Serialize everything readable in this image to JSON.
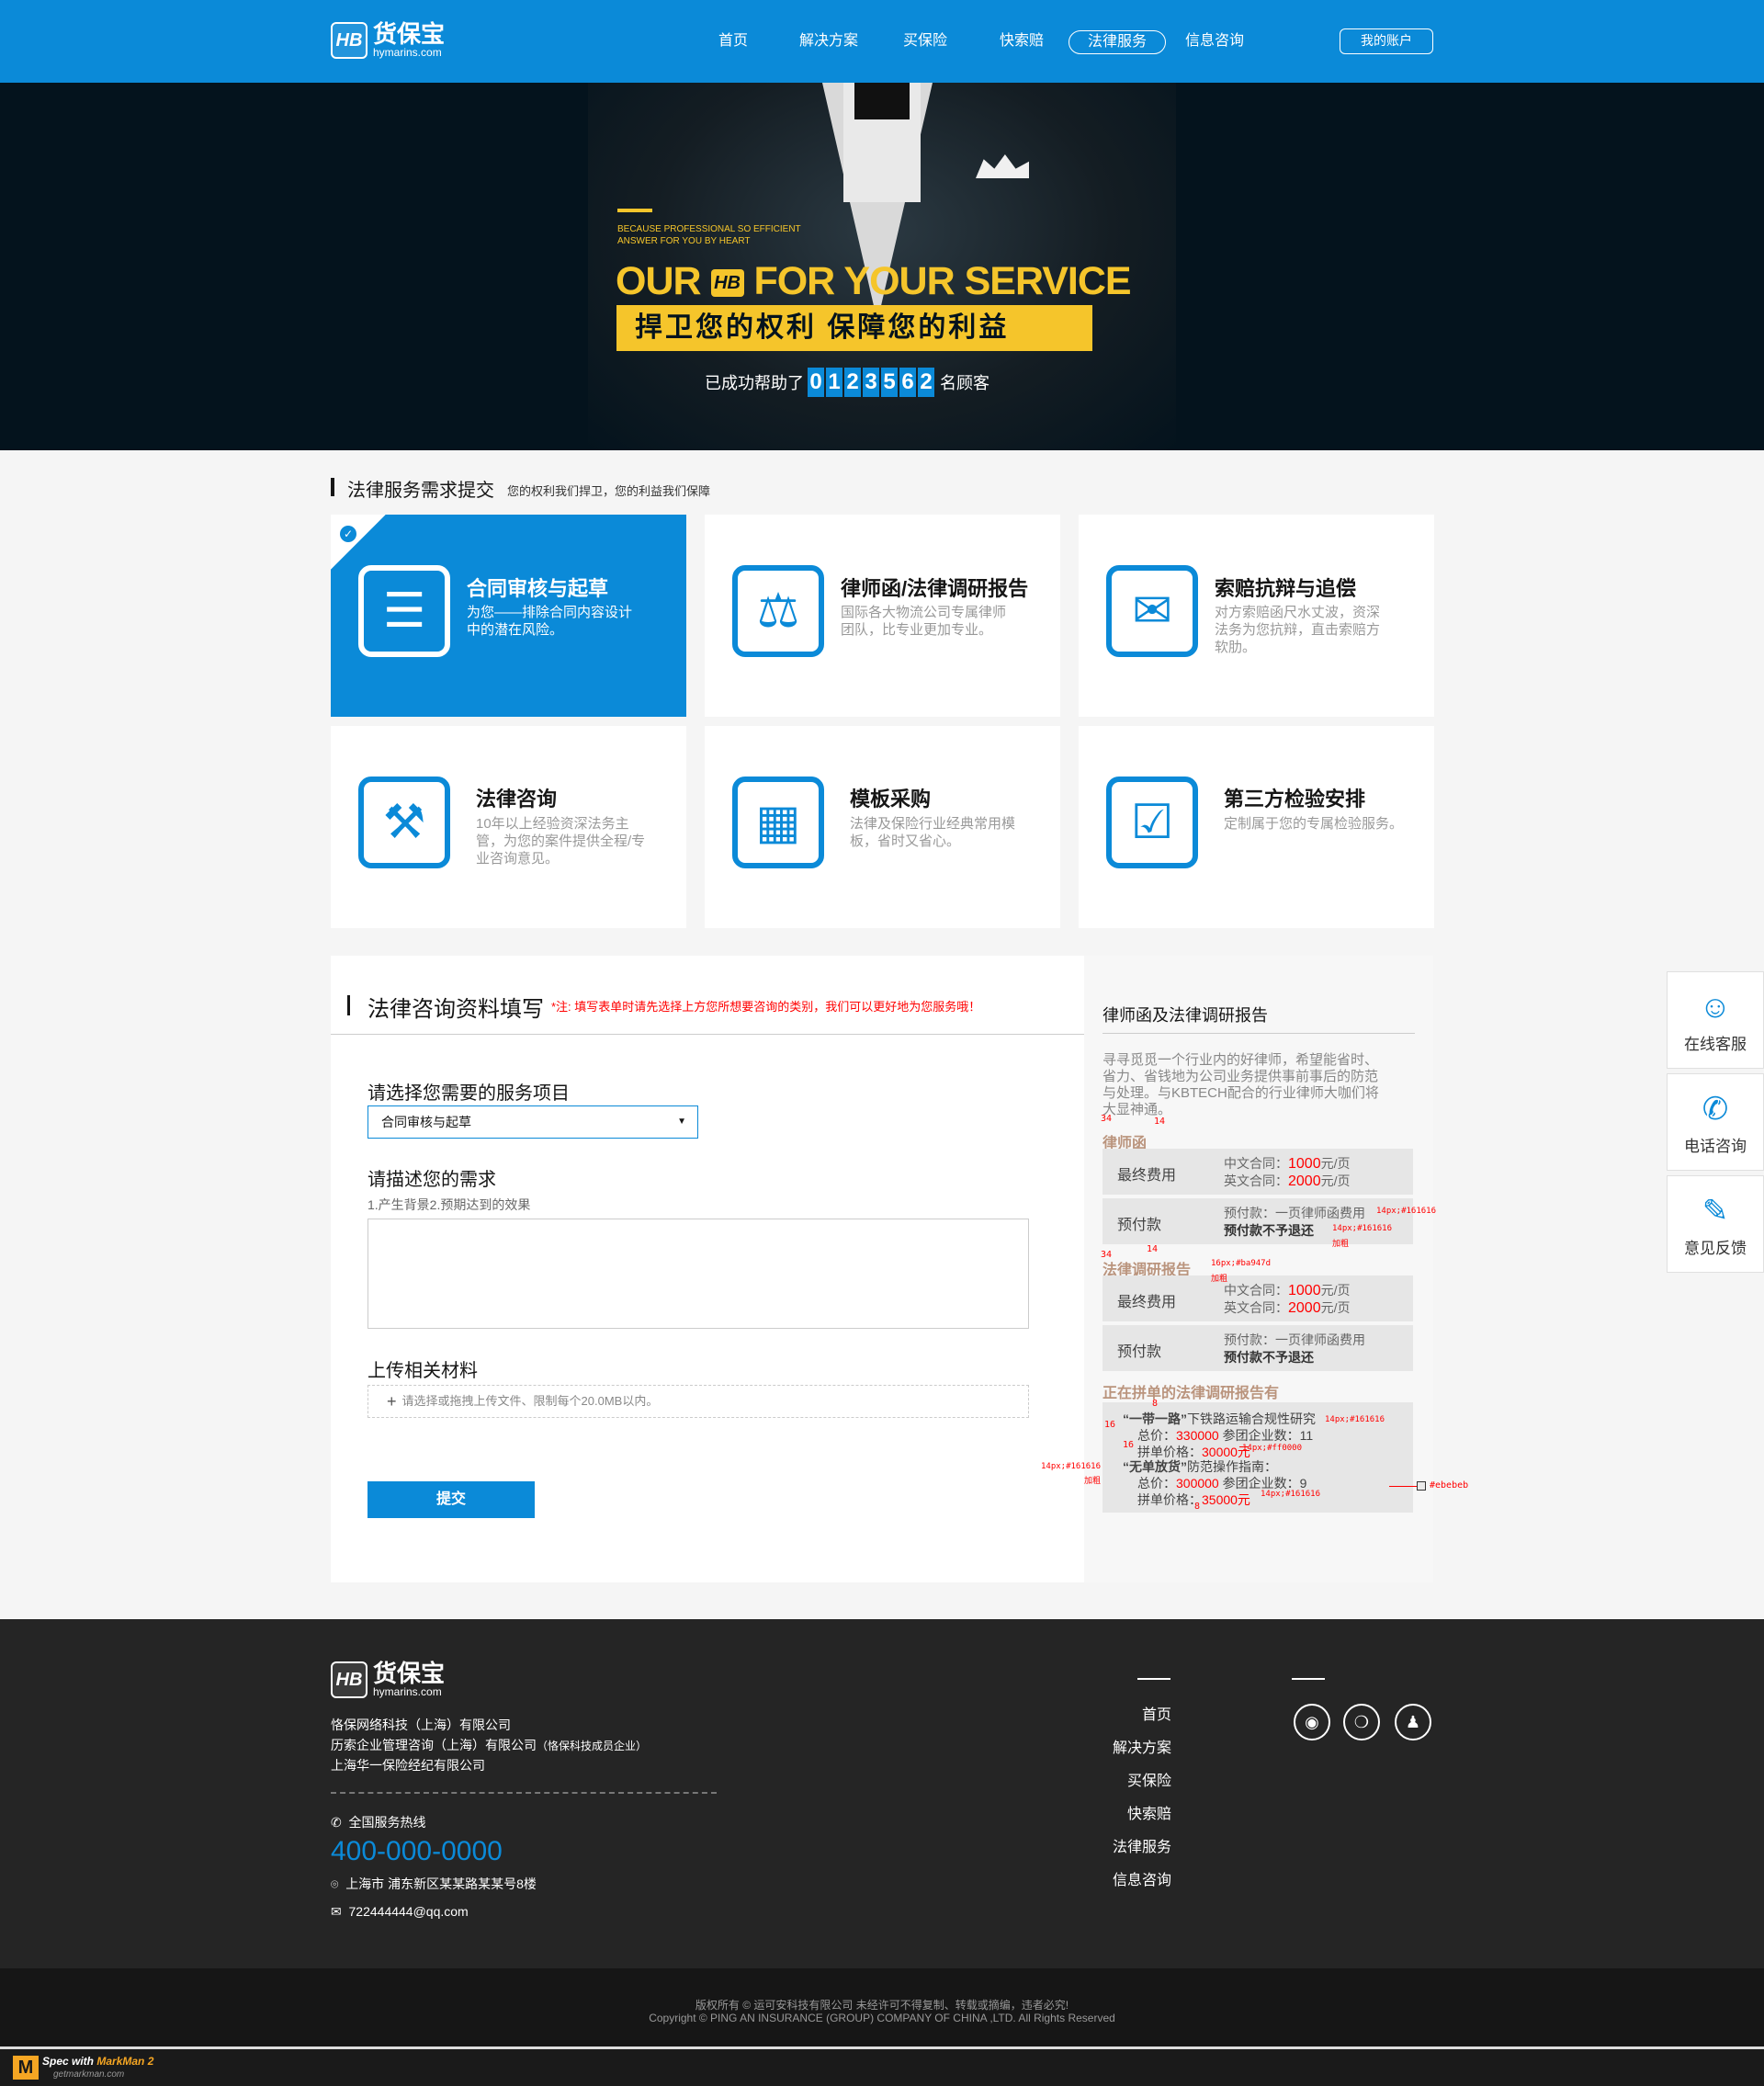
{
  "brand": {
    "name": "货保宝",
    "domain": "hymarins.com",
    "mark": "HB"
  },
  "nav": {
    "items": [
      "首页",
      "解决方案",
      "买保险",
      "快索赔",
      "法律服务",
      "信息咨询"
    ],
    "active": "法律服务",
    "account": "我的账户"
  },
  "banner": {
    "tagline_1": "BECAUSE PROFESSIONAL SO EFFICIENT",
    "tagline_2": "ANSWER FOR YOU BY HEART",
    "headline_a": "OUR",
    "headline_b": "FOR YOUR SERVICE",
    "slogan": "捍卫您的权利  保障您的利益",
    "counter_prefix": "已成功帮助了",
    "counter_digits": [
      "0",
      "1",
      "2",
      "3",
      "5",
      "6",
      "2"
    ],
    "counter_suffix": "名顾客"
  },
  "services_section": {
    "title": "法律服务需求提交",
    "subtitle": "您的权利我们捍卫，您的利益我们保障",
    "cards": [
      {
        "title": "合同审核与起草",
        "desc_1": "为您——排除合同内容设计",
        "desc_2": "中的潜在风险。",
        "desc_3": "",
        "icon": "contract-icon",
        "active": true
      },
      {
        "title": "律师函/法律调研报告",
        "desc_1": "国际各大物流公司专属律师",
        "desc_2": "团队，比专业更加专业。",
        "desc_3": "",
        "icon": "scale-icon",
        "active": false
      },
      {
        "title": "索赔抗辩与追偿",
        "desc_1": "对方索赔函尺水丈波，资深",
        "desc_2": "法务为您抗辩，直击索赔方",
        "desc_3": "软肋。",
        "icon": "claim-icon",
        "active": false
      },
      {
        "title": "法律咨询",
        "desc_1": "10年以上经验资深法务主",
        "desc_2": "管，为您的案件提供全程/专",
        "desc_3": "业咨询意见。",
        "icon": "gavel-icon",
        "active": false
      },
      {
        "title": "模板采购",
        "desc_1": "法律及保险行业经典常用模",
        "desc_2": "板，省时又省心。",
        "desc_3": "",
        "icon": "template-icon",
        "active": false
      },
      {
        "title": "第三方检验安排",
        "desc_1": "定制属于您的专属检验服务。",
        "desc_2": "",
        "desc_3": "",
        "icon": "inspection-icon",
        "active": false
      }
    ]
  },
  "form": {
    "title": "法律咨询资料填写",
    "note": "*注: 填写表单时请先选择上方您所想要咨询的类别，我们可以更好地为您服务哦！",
    "service_label": "请选择您需要的服务项目",
    "service_value": "合同审核与起草",
    "describe_label": "请描述您的需求",
    "describe_hint": "1.产生背景2.预期达到的效果",
    "upload_label": "上传相关材料",
    "upload_placeholder": "请选择或拖拽上传文件、限制每个20.0MB以内。",
    "submit": "提交"
  },
  "side": {
    "title": "律师函及法律调研报告",
    "intro_1": "寻寻觅觅一个行业内的好律师，希望能省时、",
    "intro_2": "省力、省钱地为公司业务提供事前事后的防范",
    "intro_3": "与处理。与KBTECH配合的行业律师大咖们将",
    "intro_4": "大显神通。",
    "sections": [
      {
        "heading": "律师函",
        "rows": [
          {
            "label": "最终费用",
            "l1_pre": "中文合同：",
            "l1_val": "1000",
            "l1_unit": "元/页",
            "l2_pre": "英文合同：",
            "l2_val": "2000",
            "l2_unit": "元/页"
          },
          {
            "label": "预付款",
            "l1": "预付款：一页律师函费用",
            "l2": "预付款不予退还"
          }
        ]
      },
      {
        "heading": "法律调研报告",
        "rows": [
          {
            "label": "最终费用",
            "l1_pre": "中文合同：",
            "l1_val": "1000",
            "l1_unit": "元/页",
            "l2_pre": "英文合同：",
            "l2_val": "2000",
            "l2_unit": "元/页"
          },
          {
            "label": "预付款",
            "l1": "预付款：一页律师函费用",
            "l2": "预付款不予退还"
          }
        ]
      }
    ],
    "deals_heading": "正在拼单的法律调研报告有",
    "deals": [
      {
        "name": "“一带一路”",
        "rest": "下铁路运输合规性研究",
        "total_pre": "总价：",
        "total": "330000",
        "count_pre": "参团企业数：",
        "count": "11",
        "price_pre": "拼单价格：",
        "price": "30000元"
      },
      {
        "name": "“无单放货”",
        "rest": "防范操作指南：",
        "total_pre": "总价：",
        "total": "300000",
        "count_pre": "参团企业数：",
        "count": "9",
        "price_pre": "拼单价格：",
        "price": "35000元"
      }
    ],
    "spec": {
      "v34": "34",
      "v14": "14",
      "v16": "16",
      "v8": "8",
      "s1": "14px;#161616",
      "s2": "14px;#161616",
      "s2b": "加粗",
      "s3": "16px;#ba947d",
      "s3b": "加粗",
      "s4": "14px;#161616",
      "s5": "14px;#ff0000",
      "s6": "14px;#161616",
      "s6b": "加粗",
      "s7": "14px;#161616",
      "s8": "#ebebeb"
    }
  },
  "float": [
    {
      "label": "在线客服",
      "icon": "customer-service-icon"
    },
    {
      "label": "电话咨询",
      "icon": "phone-icon"
    },
    {
      "label": "意见反馈",
      "icon": "feedback-icon"
    }
  ],
  "footer": {
    "companies": [
      "恪保网络科技（上海）有限公司",
      "历索企业管理咨询（上海）有限公司",
      "上海华一保险经纪有限公司"
    ],
    "company_2_note": "（恪保科技成员企业）",
    "hotline_label": "全国服务热线",
    "hotline": "400-000-0000",
    "address": "上海市  浦东新区某某路某某号8楼",
    "email": "722444444@qq.com",
    "links": [
      "首页",
      "解决方案",
      "买保险",
      "快索赔",
      "法律服务",
      "信息咨询"
    ],
    "social": [
      "weibo-icon",
      "wechat-icon",
      "qq-icon"
    ],
    "copyright_1": "版权所有 © 运可安科技有限公司 未经许可不得复制、转载或摘编，违者必究!",
    "copyright_2": "Copyright © PING AN INSURANCE (GROUP) COMPANY OF CHINA ,LTD. All Rights Reserved"
  },
  "markman": {
    "spec": "Spec with",
    "name": "MarkMan 2",
    "site": "getmarkman.com"
  }
}
